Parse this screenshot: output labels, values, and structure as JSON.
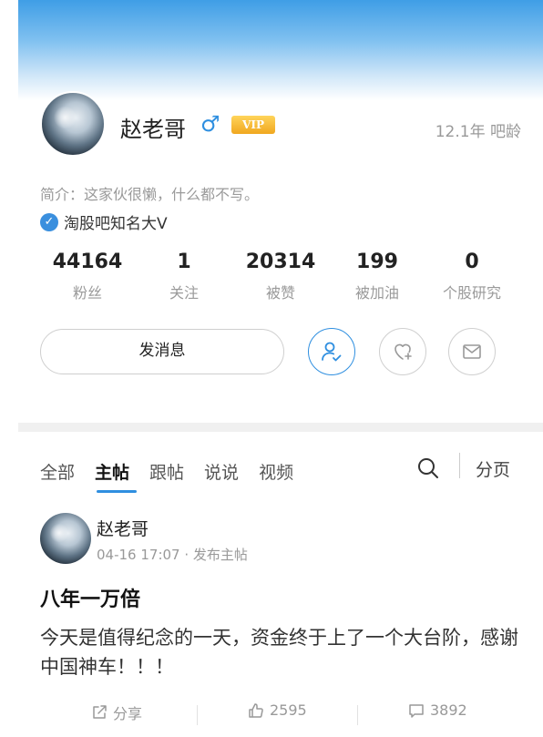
{
  "profile": {
    "username": "赵老哥",
    "gender_symbol": "♂",
    "vip_label": "VIP",
    "ba_age": "12.1年 吧龄",
    "bio": "简介：这家伙很懒，什么都不写。",
    "verified_label": "淘股吧知名大V",
    "stats": [
      {
        "value": "44164",
        "label": "粉丝"
      },
      {
        "value": "1",
        "label": "关注"
      },
      {
        "value": "20314",
        "label": "被赞"
      },
      {
        "value": "199",
        "label": "被加油"
      },
      {
        "value": "0",
        "label": "个股研究"
      }
    ],
    "message_button": "发消息"
  },
  "tabs": [
    {
      "label": "全部"
    },
    {
      "label": "主帖"
    },
    {
      "label": "跟帖"
    },
    {
      "label": "说说"
    },
    {
      "label": "视频"
    }
  ],
  "paging_label": "分页",
  "post": {
    "author": "赵老哥",
    "meta": "04-16 17:07 · 发布主帖",
    "title": "八年一万倍",
    "body": "今天是值得纪念的一天，资金终于上了一个大台阶，感谢中国神车！！！",
    "share_label": "分享",
    "likes": "2595",
    "comments": "3892"
  },
  "colors": {
    "accent": "#2f8fe0",
    "vip": "#f0a71f",
    "muted_text": "#9a9a9a"
  }
}
